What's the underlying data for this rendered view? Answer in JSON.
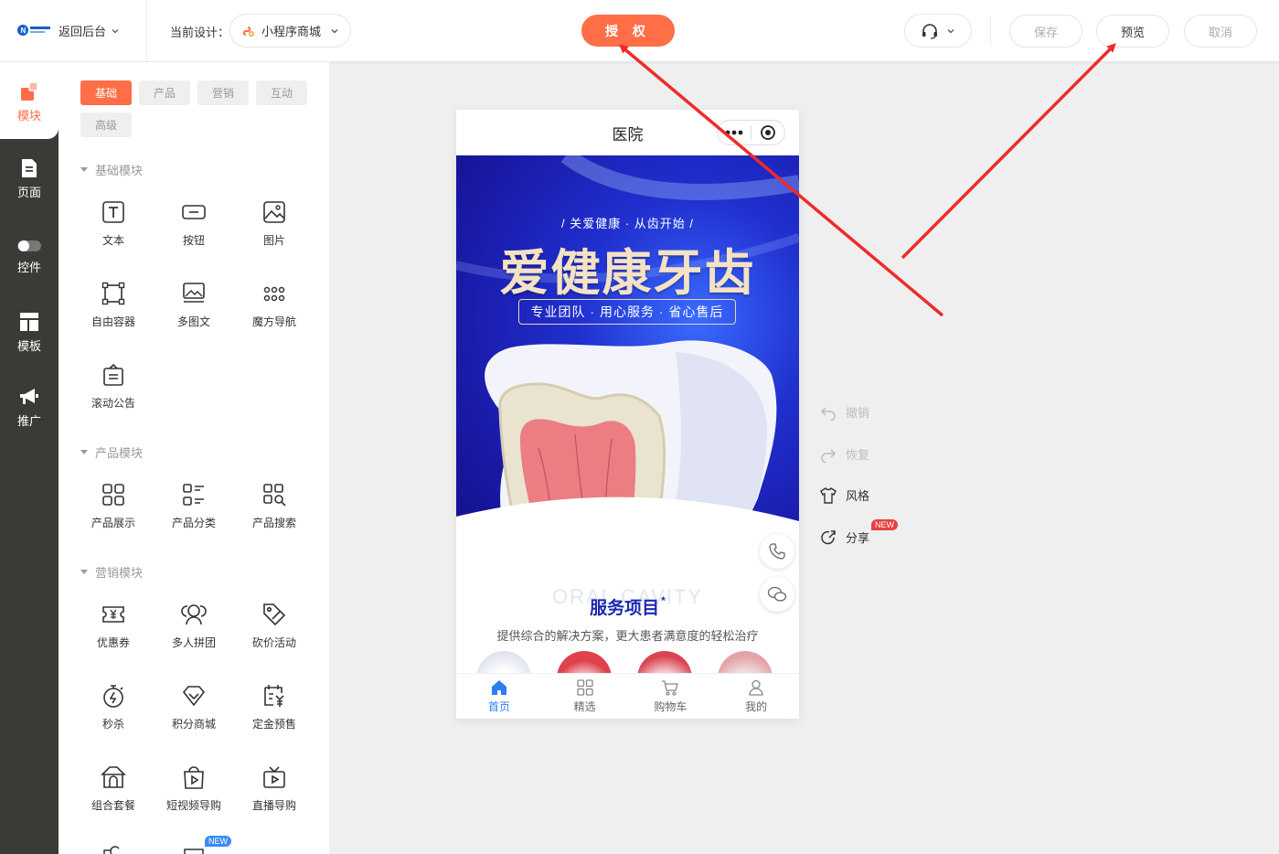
{
  "topbar": {
    "back_label": "返回后台",
    "current_design_label": "当前设计：",
    "design_name": "小程序商城",
    "auth_label": "授 权",
    "save_label": "保存",
    "preview_label": "预览",
    "cancel_label": "取消"
  },
  "left_nav": {
    "items": [
      {
        "label": "模块",
        "icon": "modules-icon",
        "active": true
      },
      {
        "label": "页面",
        "icon": "page-icon"
      },
      {
        "label": "控件",
        "icon": "toggle-icon"
      },
      {
        "label": "模板",
        "icon": "template-icon"
      },
      {
        "label": "推广",
        "icon": "megaphone-icon"
      }
    ]
  },
  "panel": {
    "tabs": [
      "基础",
      "产品",
      "营销",
      "互动",
      "高级"
    ],
    "active_tab": "基础",
    "sections": [
      {
        "title": "基础模块",
        "items": [
          "文本",
          "按钮",
          "图片",
          "自由容器",
          "多图文",
          "魔方导航",
          "滚动公告"
        ]
      },
      {
        "title": "产品模块",
        "items": [
          "产品展示",
          "产品分类",
          "产品搜索"
        ]
      },
      {
        "title": "营销模块",
        "items": [
          "优惠券",
          "多人拼团",
          "砍价活动",
          "秒杀",
          "积分商城",
          "定金预售",
          "组合套餐",
          "短视频导购",
          "直播导购"
        ]
      }
    ],
    "new_badge": "NEW"
  },
  "phone": {
    "title": "医院",
    "banner": {
      "subtitle": "/ 关爱健康 · 从齿开始 /",
      "title": "爱健康牙齿",
      "tagline": "专业团队 · 用心服务 · 省心售后"
    },
    "service_ghost": "ORAL CAVITY",
    "service_title": "服务项目",
    "service_desc": "提供综合的解决方案，更大患者满意度的轻松治疗",
    "tabbar": [
      {
        "label": "首页",
        "icon": "home-icon",
        "active": true
      },
      {
        "label": "精选",
        "icon": "grid-icon"
      },
      {
        "label": "购物车",
        "icon": "cart-icon"
      },
      {
        "label": "我的",
        "icon": "user-icon"
      }
    ]
  },
  "right_actions": {
    "undo": "撤销",
    "redo": "恢复",
    "style": "风格",
    "share": "分享",
    "share_badge": "NEW"
  },
  "colors": {
    "accent": "#ff6e46",
    "nav_dark": "#3c3a37",
    "annotation_arrow": "#f02a2a",
    "tab_active_blue": "#2b7ff2"
  }
}
